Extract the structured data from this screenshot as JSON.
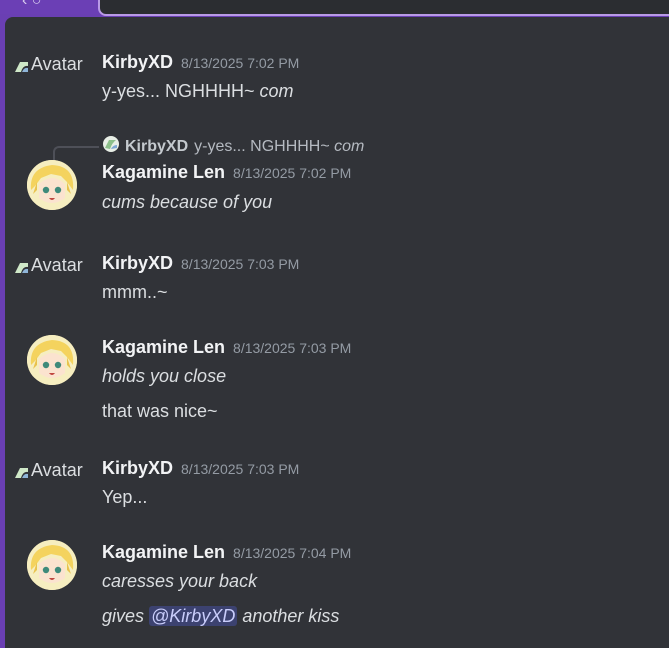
{
  "messages": [
    {
      "author": "KirbyXD",
      "time": "8/13/2025 7:02 PM",
      "avatar_alt": "Avatar",
      "lines": [
        "y-yes... NGHHHH~ |com"
      ]
    },
    {
      "reply": {
        "author": "KirbyXD",
        "text": "y-yes... NGHHHH~ ",
        "italic": "com"
      },
      "author": "Kagamine Len",
      "time": "8/13/2025 7:02 PM",
      "lines": [
        "cums because of you"
      ]
    },
    {
      "author": "KirbyXD",
      "time": "8/13/2025 7:03 PM",
      "avatar_alt": "Avatar",
      "lines": [
        "mmm..~"
      ]
    },
    {
      "author": "Kagamine Len",
      "time": "8/13/2025 7:03 PM",
      "lines": [
        "holds you close",
        "that was nice~"
      ]
    },
    {
      "author": "KirbyXD",
      "time": "8/13/2025 7:03 PM",
      "avatar_alt": "Avatar",
      "lines": [
        "Yep..."
      ]
    },
    {
      "author": "Kagamine Len",
      "time": "8/13/2025 7:04 PM",
      "lines": [
        "caresses your back",
        "gives ",
        "@KirbyXD",
        " another kiss"
      ]
    }
  ],
  "m1": {
    "author": "KirbyXD",
    "time": "8/13/2025 7:02 PM",
    "alt": "Avatar",
    "text": "y-yes... NGHHHH~ ",
    "text_italic": "com"
  },
  "m2": {
    "reply_author": "KirbyXD",
    "reply_text": "y-yes... NGHHHH~ ",
    "reply_italic": "com",
    "author": "Kagamine Len",
    "time": "8/13/2025 7:02 PM",
    "text": "cums because of you"
  },
  "m3": {
    "author": "KirbyXD",
    "time": "8/13/2025 7:03 PM",
    "alt": "Avatar",
    "text": "mmm..~"
  },
  "m4": {
    "author": "Kagamine Len",
    "time": "8/13/2025 7:03 PM",
    "text1": "holds you close",
    "text2": "that was nice~"
  },
  "m5": {
    "author": "KirbyXD",
    "time": "8/13/2025 7:03 PM",
    "alt": "Avatar",
    "text": "Yep..."
  },
  "m6": {
    "author": "Kagamine Len",
    "time": "8/13/2025 7:04 PM",
    "text1": "caresses your back",
    "text2_pre": "gives ",
    "mention": "@KirbyXD",
    "text2_post": " another kiss"
  },
  "colors": {
    "chat_bg": "#313338",
    "frame": "#6a3fb3",
    "mention_bg": "#3c4270"
  }
}
